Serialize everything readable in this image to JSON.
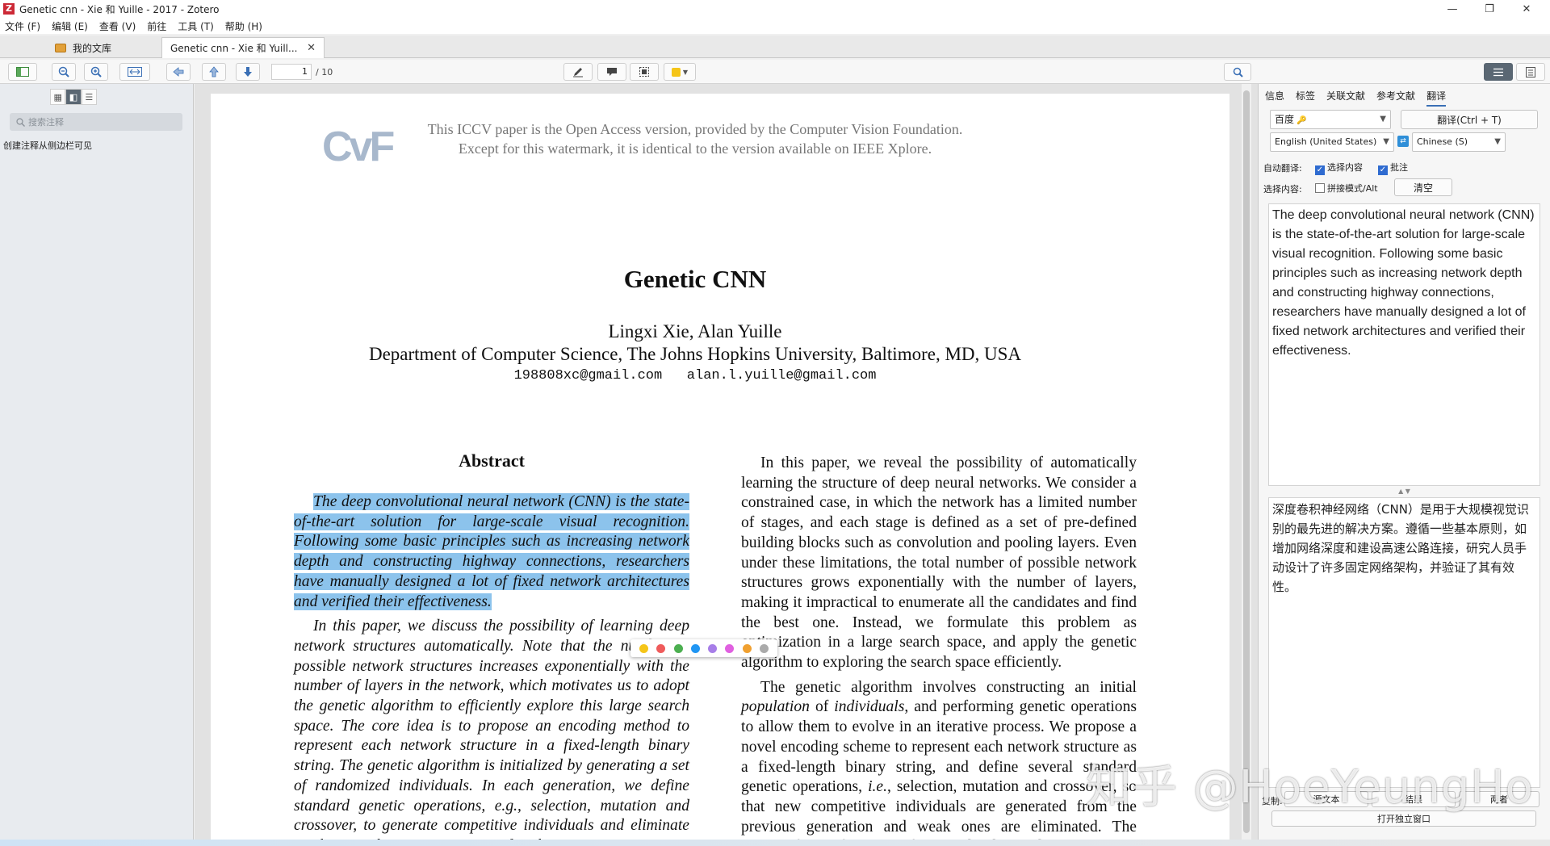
{
  "window": {
    "title": "Genetic cnn - Xie 和 Yuille - 2017 - Zotero",
    "controls": [
      "—",
      "❐",
      "✕"
    ]
  },
  "menu": [
    "文件 (F)",
    "编辑 (E)",
    "查看 (V)",
    "前往",
    "工具 (T)",
    "帮助 (H)"
  ],
  "tabs": {
    "library": "我的文库",
    "pdf": "Genetic cnn - Xie 和 Yuill...",
    "close": "✕"
  },
  "toolbar": {
    "page_current": "1",
    "page_total": "/ 10"
  },
  "left_sidebar": {
    "search_placeholder": "搜索注释",
    "hint": "创建注释从侧边栏可见"
  },
  "pdf": {
    "watermark_line1": "This ICCV paper is the Open Access version, provided by the Computer Vision Foundation.",
    "watermark_line2": "Except for this watermark, it is identical to the version available on IEEE Xplore.",
    "cvf_logo": "CvF",
    "title": "Genetic CNN",
    "authors": "Lingxi Xie, Alan Yuille",
    "affiliation": "Department of Computer Science, The Johns Hopkins University, Baltimore, MD, USA",
    "emails": "198808xc@gmail.com   alan.l.yuille@gmail.com",
    "abstract_heading": "Abstract",
    "abstract_highlighted": "The deep convolutional neural network (CNN) is the state-of-the-art solution for large-scale visual recognition. Following some basic principles such as increasing network depth and constructing highway connections, researchers have manually designed a lot of fixed network architectures and verified their effectiveness.",
    "abstract_p2": "In this paper, we discuss the possibility of learning deep network structures automatically. Note that the number of possible network structures increases exponentially with the number of layers in the network, which motivates us to adopt the genetic algorithm to efficiently explore this large search space. The core idea is to propose an encoding method to represent each network structure in a fixed-length binary string. The genetic algorithm is initialized by generating a set of randomized individuals. In each generation, we define standard genetic operations, e.g., selection, mutation and crossover, to generate competitive individuals and eliminate weak ones. The competitiveness of each",
    "right_p1": "In this paper, we reveal the possibility of automatically learning the structure of deep neural networks. We consider a constrained case, in which the network has a limited number of stages, and each stage is defined as a set of pre-defined building blocks such as convolution and pooling layers. Even under these limitations, the total number of possible network structures grows exponentially with the number of layers, making it impractical to enumerate all the candidates and find the best one. Instead, we formulate this problem as optimization in a large search space, and apply the genetic algorithm to exploring the search space efficiently.",
    "right_p2_a": "The genetic algorithm involves constructing an initial ",
    "right_p2_em1": "population",
    "right_p2_b": " of ",
    "right_p2_em2": "individuals",
    "right_p2_c": ", and performing genetic operations to allow them to evolve in an iterative process. We propose a novel encoding scheme to represent each network structure as a fixed-length binary string, and define several standard genetic operations, ",
    "right_p2_em3": "i.e.",
    "right_p2_d": ", selection, mutation and crossover, so that new competitive individuals are generated from the previous generation and weak ones are eliminated. The quality (fitness function) of each individual is det"
  },
  "highlight_colors": [
    "#f5c518",
    "#ef5b5b",
    "#4caf50",
    "#2196f3",
    "#a77ee8",
    "#e060e0",
    "#f0a030",
    "#aaaaaa"
  ],
  "right_panel": {
    "tabs": [
      "信息",
      "标签",
      "关联文献",
      "参考文献",
      "翻译"
    ],
    "engine": "百度",
    "translate_button": "翻译(Ctrl + T)",
    "source_lang": "English (United States)",
    "target_lang": "Chinese (S)",
    "auto_translate_label": "自动翻译:",
    "option_selection": "选择内容",
    "option_annotation": "批注",
    "selection_label": "选择内容:",
    "option_concat": "拼接模式/Alt",
    "clear_button": "清空",
    "source_text": "The deep convolutional neural network (CNN) is the state-of-the-art solution for large-scale visual recognition. Following some basic principles such as increasing network depth and constructing highway connections, researchers have manually designed a lot of fixed network architectures and verified their effectiveness.",
    "result_text": "深度卷积神经网络（CNN）是用于大规模视觉识别的最先进的解决方案。遵循一些基本原则，如增加网络深度和建设高速公路连接，研究人员手动设计了许多固定网络架构，并验证了其有效性。",
    "copy_label": "复制:",
    "copy_source": "源文本",
    "copy_result": "结果",
    "copy_both": "两者",
    "open_window": "打开独立窗口"
  },
  "overlay_watermark": "知乎 @HoeYeungHo"
}
